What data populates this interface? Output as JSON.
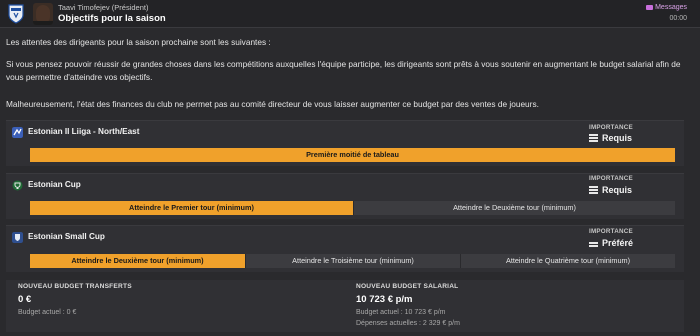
{
  "header": {
    "sender": "Taavi Timofejev  (Président)",
    "subject": "Objectifs pour la saison",
    "tag": "Messages",
    "time": "00:00"
  },
  "intro": {
    "p1": "Les attentes des dirigeants pour la saison prochaine sont les suivantes :",
    "p2": "Si vous pensez pouvoir réussir de grandes choses dans les compétitions auxquelles l'équipe participe, les dirigeants sont prêts à vous soutenir en augmentant le budget salarial afin de vous permettre d'atteindre vos objectifs.",
    "p3": "Malheureusement, l'état des finances du club ne permet pas au comité directeur de vous laisser augmenter ce budget par des ventes de joueurs."
  },
  "importance_label": "IMPORTANCE",
  "objectives": [
    {
      "competition": "Estonian II Liiga - North/East",
      "importance": "Requis",
      "options": [
        {
          "label": "Première moitié de tableau",
          "active": true
        }
      ]
    },
    {
      "competition": "Estonian Cup",
      "importance": "Requis",
      "options": [
        {
          "label": "Atteindre le Premier tour (minimum)",
          "active": true
        },
        {
          "label": "Atteindre le Deuxième tour (minimum)",
          "active": false
        }
      ]
    },
    {
      "competition": "Estonian Small Cup",
      "importance": "Préféré",
      "options": [
        {
          "label": "Atteindre le Deuxième tour (minimum)",
          "active": true
        },
        {
          "label": "Atteindre le Troisième tour (minimum)",
          "active": false
        },
        {
          "label": "Atteindre le Quatrième tour (minimum)",
          "active": false
        }
      ]
    }
  ],
  "budget": {
    "transfer": {
      "label": "NOUVEAU BUDGET TRANSFERTS",
      "value": "0 €",
      "current": "Budget actuel : 0 €"
    },
    "salary": {
      "label": "NOUVEAU BUDGET SALARIAL",
      "value": "10 723 € p/m",
      "current": "Budget actuel : 10 723 € p/m",
      "spent": "Dépenses actuelles : 2 329 € p/m"
    }
  },
  "colors": {
    "accent": "#f0a12b",
    "background": "#2a2a2d",
    "card": "#303034",
    "messages_tag": "#c86fdc"
  }
}
